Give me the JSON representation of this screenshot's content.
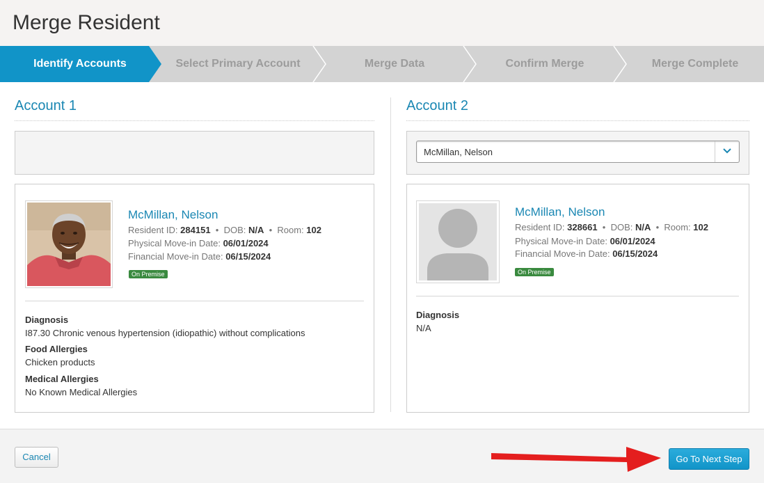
{
  "page": {
    "title": "Merge Resident"
  },
  "steps": [
    {
      "label": "Identify Accounts",
      "active": true
    },
    {
      "label": "Select Primary Account",
      "active": false
    },
    {
      "label": "Merge Data",
      "active": false
    },
    {
      "label": "Confirm Merge",
      "active": false
    },
    {
      "label": "Merge Complete",
      "active": false
    }
  ],
  "colors": {
    "accent": "#1a87b3",
    "active_step": "#1194c8",
    "inactive_step": "#d3d3d3",
    "badge": "#3a8a3f",
    "arrow": "#e41e1e"
  },
  "account1": {
    "title": "Account 1",
    "resident": {
      "name": "McMillan, Nelson",
      "id_label": "Resident ID:",
      "id": "284151",
      "dob_label": "DOB:",
      "dob": "N/A",
      "room_label": "Room:",
      "room": "102",
      "physical_label": "Physical Move-in Date:",
      "physical_date": "06/01/2024",
      "financial_label": "Financial Move-in Date:",
      "financial_date": "06/15/2024",
      "badge": "On Premise"
    },
    "details": [
      {
        "label": "Diagnosis",
        "value": "I87.30 Chronic venous hypertension (idiopathic) without complications"
      },
      {
        "label": "Food Allergies",
        "value": "Chicken products"
      },
      {
        "label": "Medical Allergies",
        "value": "No Known Medical Allergies"
      }
    ]
  },
  "account2": {
    "title": "Account 2",
    "select_value": "McMillan, Nelson",
    "resident": {
      "name": "McMillan, Nelson",
      "id_label": "Resident ID:",
      "id": "328661",
      "dob_label": "DOB:",
      "dob": "N/A",
      "room_label": "Room:",
      "room": "102",
      "physical_label": "Physical Move-in Date:",
      "physical_date": "06/01/2024",
      "financial_label": "Financial Move-in Date:",
      "financial_date": "06/15/2024",
      "badge": "On Premise"
    },
    "details": [
      {
        "label": "Diagnosis",
        "value": "N/A"
      }
    ]
  },
  "footer": {
    "cancel_label": "Cancel",
    "next_label": "Go To Next Step"
  }
}
